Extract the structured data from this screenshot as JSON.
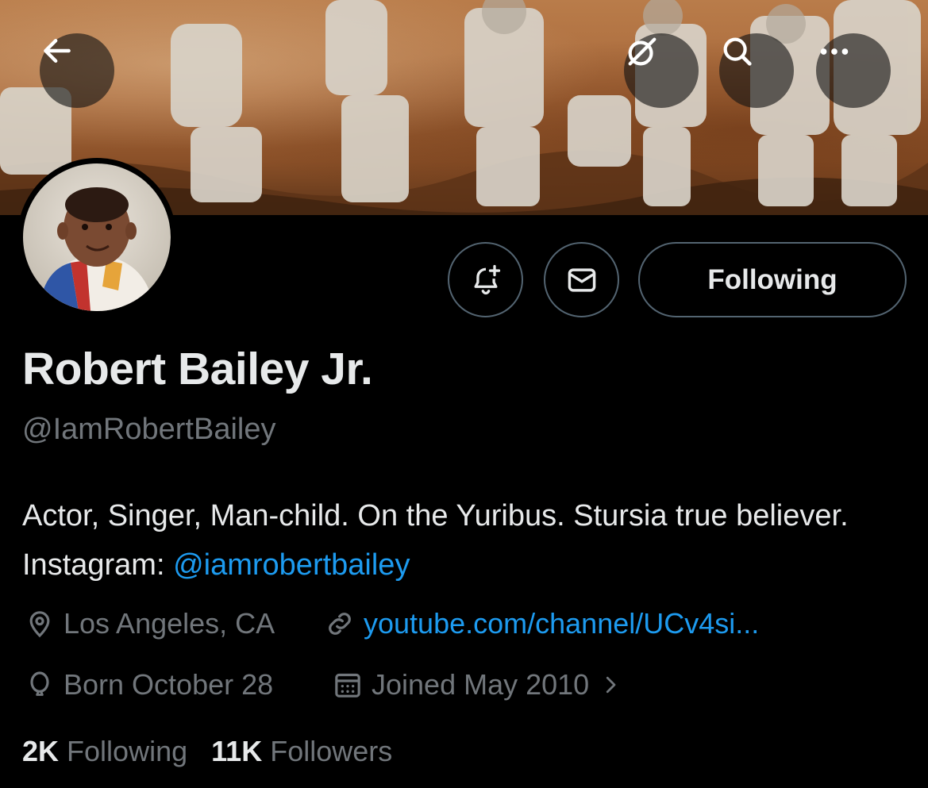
{
  "header": {
    "back_icon": "arrow-left-icon",
    "grok_icon": "grok-slash-circle-icon",
    "search_icon": "search-icon",
    "more_icon": "more-dots-icon"
  },
  "profile": {
    "name": "Robert Bailey Jr.",
    "handle": "@IamRobertBailey",
    "bio_text": "Actor, Singer, Man-child. On the Yuribus. Stursia true believer. Instagram: ",
    "bio_link": "@iamrobertbailey",
    "location": "Los Angeles, CA",
    "website": "youtube.com/channel/UCv4si...",
    "birthday": "Born October 28",
    "joined": "Joined May 2010",
    "following_count": "2K",
    "following_label": "Following",
    "followers_count": "11K",
    "followers_label": "Followers"
  },
  "actions": {
    "notify_icon": "bell-plus-icon",
    "message_icon": "envelope-icon",
    "follow_button_label": "Following"
  },
  "colors": {
    "background": "#000000",
    "text": "#e7e9ea",
    "muted": "#71767b",
    "link": "#1d9bf0",
    "border": "#536471"
  }
}
